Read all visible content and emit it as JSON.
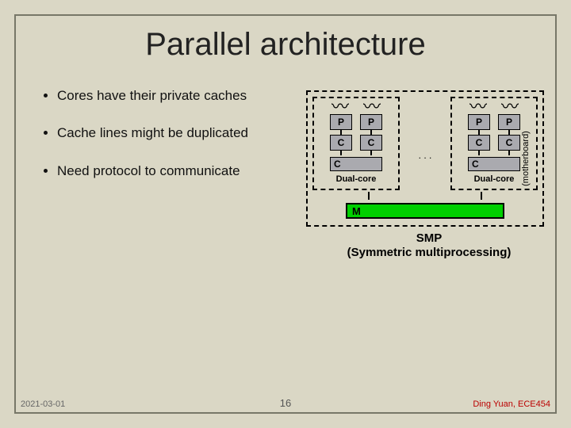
{
  "title": "Parallel architecture",
  "bullets": {
    "b0": "Cores have their private caches",
    "b1": "Cache lines might be duplicated",
    "b2": "Need protocol to communicate"
  },
  "diagram": {
    "motherboard_label": "(motherboard)",
    "P": "P",
    "C": "C",
    "M": "M",
    "dots": ". . .",
    "dual_core": "Dual-core",
    "smp_line1": "SMP",
    "smp_line2": "(Symmetric multiprocessing)"
  },
  "footer": {
    "date": "2021-03-01",
    "page": "16",
    "author": "Ding Yuan, ECE454"
  }
}
